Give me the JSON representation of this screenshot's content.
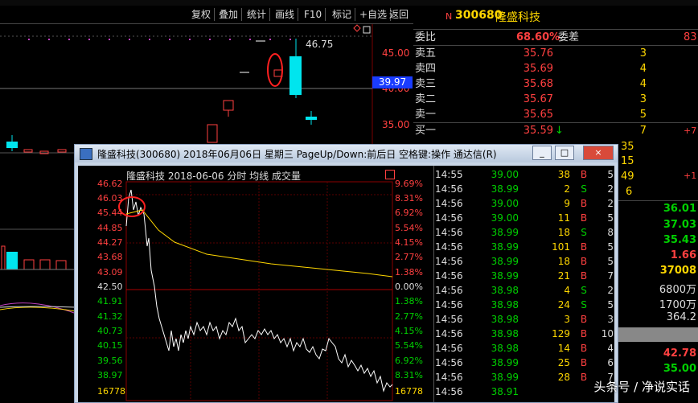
{
  "toolbar": {
    "items": [
      "复权",
      "叠加",
      "统计",
      "画线",
      "F10",
      "标记",
      "+自选",
      "返回"
    ]
  },
  "main_chart": {
    "price_labels": [
      "45.00",
      "40.00",
      "35.00"
    ],
    "high_label": "46.75",
    "current_price": "39.97"
  },
  "quote": {
    "code": "300680",
    "name": "隆盛科技",
    "weibi_label": "委比",
    "weibi_value": "68.60%",
    "weicha_label": "委差",
    "weicha_value": "83",
    "asks": [
      {
        "label": "卖五",
        "price": "35.76",
        "vol": "3"
      },
      {
        "label": "卖四",
        "price": "35.69",
        "vol": "4"
      },
      {
        "label": "卖三",
        "price": "35.68",
        "vol": "4"
      },
      {
        "label": "卖二",
        "price": "35.67",
        "vol": "3"
      },
      {
        "label": "卖一",
        "price": "35.65",
        "vol": "5"
      }
    ],
    "bid1": {
      "label": "买一",
      "price": "35.59",
      "arrow": "↓",
      "vol": "7",
      "chg": "+7"
    },
    "right_vols": [
      "35",
      "15",
      "49",
      "6"
    ],
    "right_plus": "+1",
    "right_stats": [
      "36.01",
      "37.03",
      "35.43",
      "1.66",
      "37008",
      "6800万",
      "1700万",
      "364.2",
      "42.78",
      "35.00"
    ]
  },
  "popup": {
    "title": "隆盛科技(300680) 2018年06月06日 星期三 PageUp/Down:前后日 空格键:操作 通达信(R)",
    "btn_min": "_",
    "btn_max": "□",
    "btn_close": "×",
    "header": "隆盛科技  2018-06-06 分时 均线 成交量",
    "ma_label": "均线",
    "vol_label": "成交量",
    "left_axis": [
      "46.62",
      "46.03",
      "45.44",
      "44.85",
      "44.27",
      "43.68",
      "43.09",
      "42.50",
      "41.91",
      "41.32",
      "40.73",
      "40.15",
      "39.56",
      "38.97",
      "16778"
    ],
    "right_axis": [
      "9.69%",
      "8.31%",
      "6.92%",
      "5.54%",
      "4.15%",
      "2.77%",
      "1.38%",
      "0.00%",
      "1.38%",
      "2.77%",
      "4.15%",
      "5.54%",
      "6.92%",
      "8.31%",
      "16778"
    ],
    "ticks": [
      {
        "time": "14:55",
        "price": "39.00",
        "vol": "38",
        "bs": "B",
        "n": "5"
      },
      {
        "time": "14:56",
        "price": "38.99",
        "vol": "2",
        "bs": "S",
        "n": "2"
      },
      {
        "time": "14:56",
        "price": "39.00",
        "vol": "9",
        "bs": "B",
        "n": "2"
      },
      {
        "time": "14:56",
        "price": "39.00",
        "vol": "11",
        "bs": "B",
        "n": "5"
      },
      {
        "time": "14:56",
        "price": "38.99",
        "vol": "18",
        "bs": "S",
        "n": "8"
      },
      {
        "time": "14:56",
        "price": "38.99",
        "vol": "101",
        "bs": "B",
        "n": "5"
      },
      {
        "time": "14:56",
        "price": "38.99",
        "vol": "18",
        "bs": "B",
        "n": "5"
      },
      {
        "time": "14:56",
        "price": "38.99",
        "vol": "21",
        "bs": "B",
        "n": "7"
      },
      {
        "time": "14:56",
        "price": "38.98",
        "vol": "4",
        "bs": "S",
        "n": "2"
      },
      {
        "time": "14:56",
        "price": "38.98",
        "vol": "24",
        "bs": "S",
        "n": "5"
      },
      {
        "time": "14:56",
        "price": "38.98",
        "vol": "3",
        "bs": "B",
        "n": "3"
      },
      {
        "time": "14:56",
        "price": "38.98",
        "vol": "129",
        "bs": "B",
        "n": "10"
      },
      {
        "time": "14:56",
        "price": "38.98",
        "vol": "14",
        "bs": "B",
        "n": "4"
      },
      {
        "time": "14:56",
        "price": "38.99",
        "vol": "25",
        "bs": "B",
        "n": "6"
      },
      {
        "time": "14:56",
        "price": "38.99",
        "vol": "28",
        "bs": "B",
        "n": "7"
      },
      {
        "time": "14:56",
        "price": "38.91",
        "vol": "",
        "bs": "",
        "n": ""
      }
    ]
  },
  "watermark": "头条号 / 净说实话",
  "colors": {
    "up": "#ff4040",
    "down": "#00d000",
    "cyan": "#00e5ee",
    "yellow": "#ffd700"
  }
}
